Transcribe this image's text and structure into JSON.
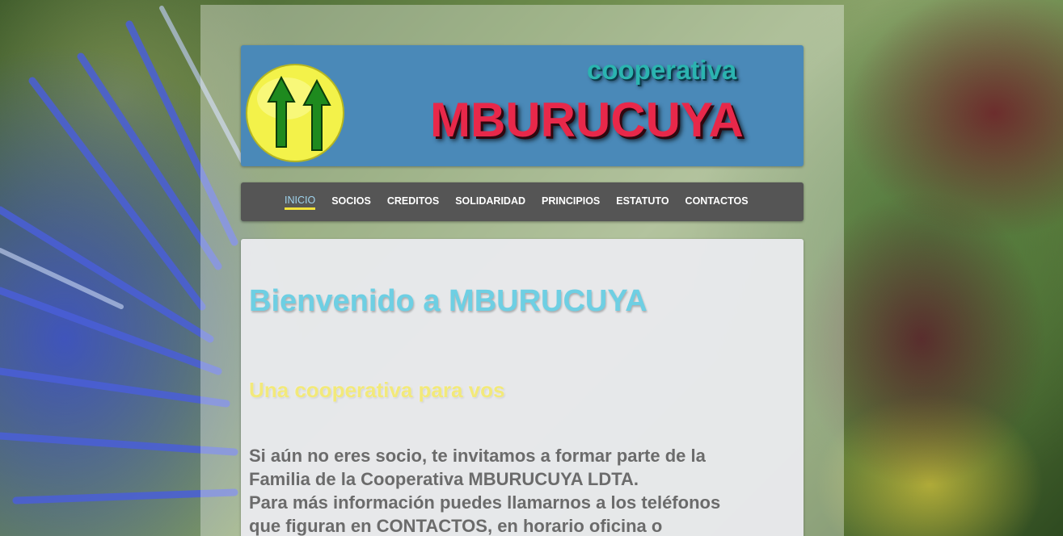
{
  "header": {
    "brand_small": "cooperativa",
    "brand_big": "MBURUCUYA"
  },
  "nav": {
    "items": [
      {
        "label": "INICIO",
        "active": true
      },
      {
        "label": "SOCIOS",
        "active": false
      },
      {
        "label": "CREDITOS",
        "active": false
      },
      {
        "label": "SOLIDARIDAD",
        "active": false
      },
      {
        "label": "PRINCIPIOS",
        "active": false
      },
      {
        "label": "ESTATUTO",
        "active": false
      },
      {
        "label": "CONTACTOS",
        "active": false
      }
    ]
  },
  "main": {
    "title": "Bienvenido a MBURUCUYA",
    "subtitle": "Una cooperativa para vos",
    "body_lines": [
      "Si aún no eres socio, te invitamos a formar parte de la",
      "Familia de la Cooperativa MBURUCUYA LDTA.",
      "Para más información puedes llamarnos a los teléfonos",
      "que figuran en CONTACTOS, en horario oficina o"
    ]
  },
  "colors": {
    "header_bg": "#4a89b8",
    "brand_small": "#2bb4b0",
    "brand_big": "#e8284a",
    "nav_bg": "#555555",
    "nav_active": "#9fd4ee",
    "nav_active_underline": "#f2e23a",
    "title": "#6ecfe3",
    "subtitle": "#f2e97a",
    "body_text": "#6b6b6b"
  }
}
